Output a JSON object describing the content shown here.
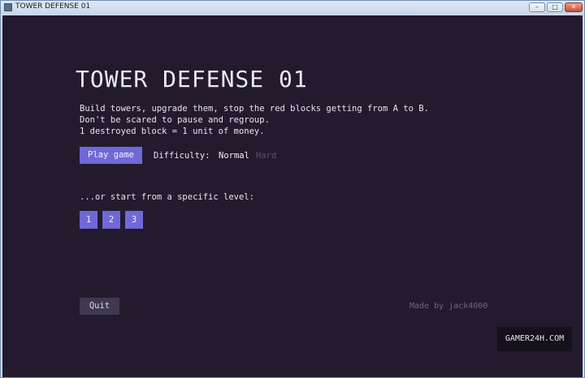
{
  "window": {
    "title": "TOWER DEFENSE 01",
    "controls": {
      "minimize": "–",
      "maximize": "□",
      "close": "✕"
    }
  },
  "game": {
    "title": "TOWER DEFENSE 01",
    "description": [
      "Build towers, upgrade them, stop the red blocks getting from A to B.",
      "Don't be scared to pause and regroup.",
      "1 destroyed block = 1 unit of money."
    ],
    "play_label": "Play game",
    "difficulty_label": "Difficulty:",
    "difficulty_options": [
      "Normal",
      "Hard"
    ],
    "difficulty_selected": "Normal",
    "level_prompt": "...or start from a specific level:",
    "levels": [
      "1",
      "2",
      "3"
    ],
    "quit_label": "Quit",
    "credit": "Made by jack4000"
  },
  "watermark": "GAMER24H.COM",
  "colors": {
    "background": "#231a2e",
    "button": "#6f69d8",
    "quit_button": "#3e3850",
    "text": "#e7e4ee",
    "inactive_option": "#5a5366"
  }
}
